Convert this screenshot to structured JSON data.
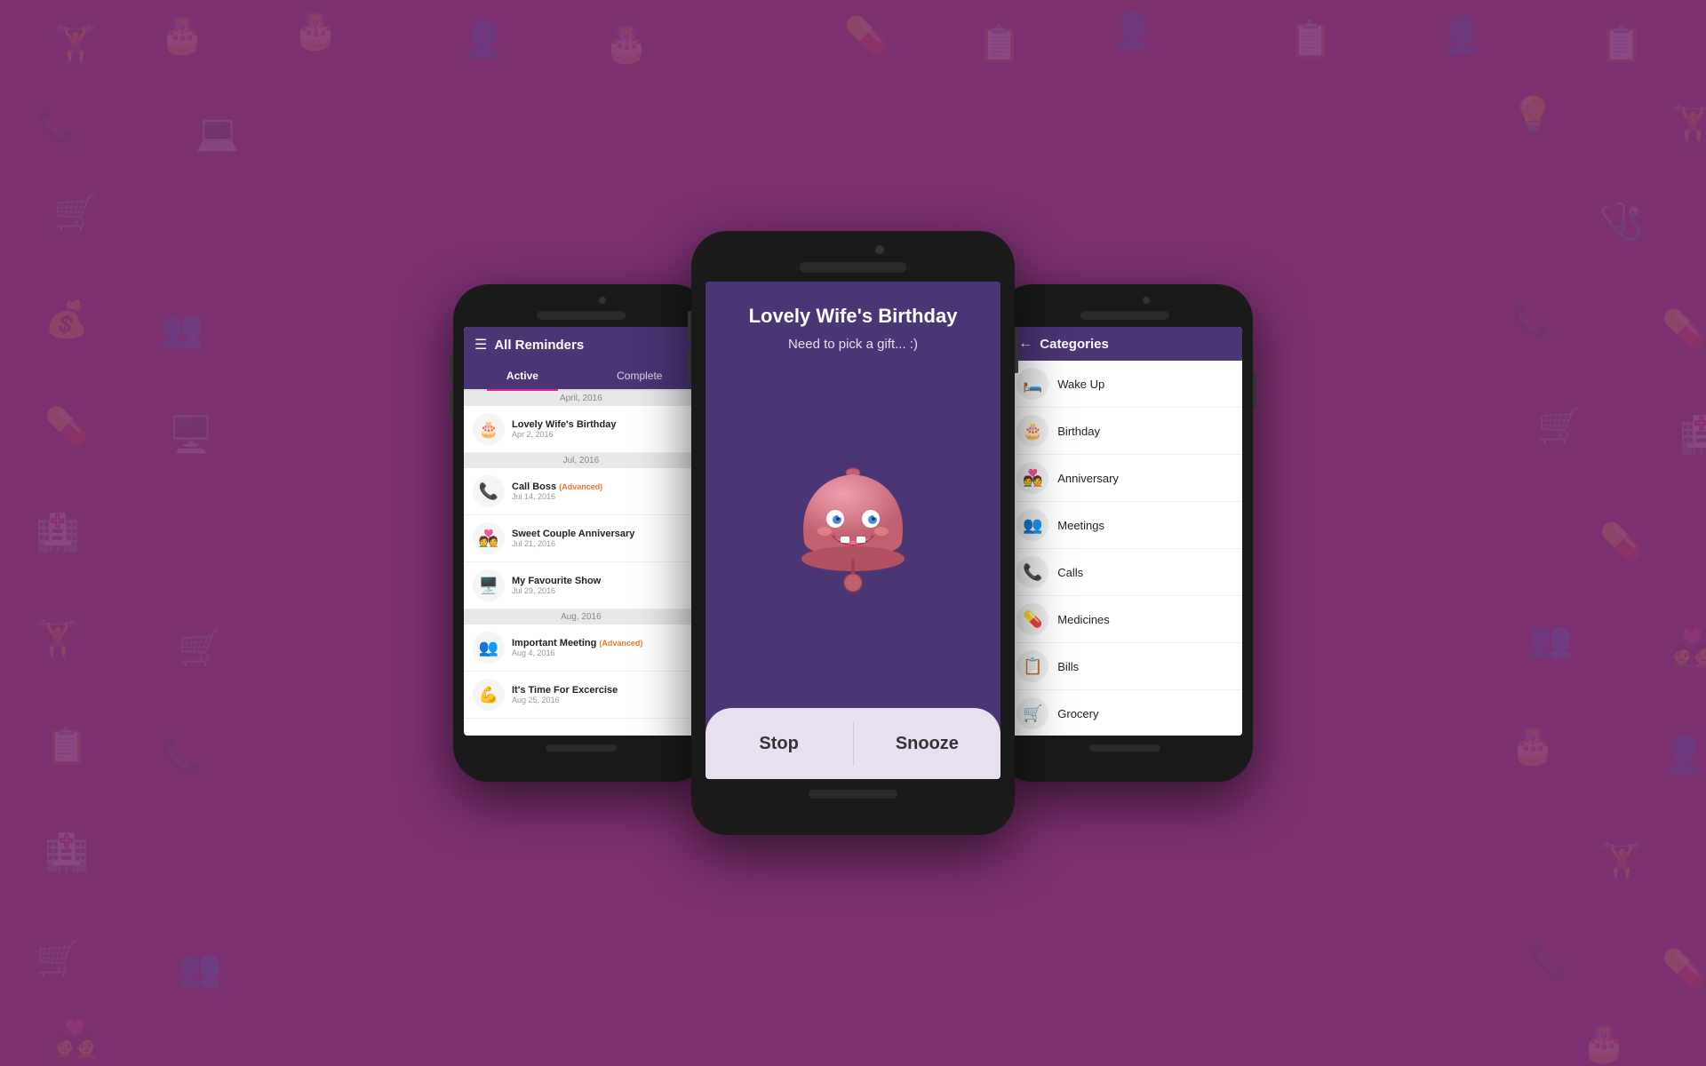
{
  "background": {
    "color": "#7b3070"
  },
  "phone_left": {
    "header": {
      "menu_icon": "☰",
      "title": "All Reminders"
    },
    "tabs": [
      {
        "label": "Active",
        "active": true
      },
      {
        "label": "Complete",
        "active": false
      }
    ],
    "sections": [
      {
        "month": "April, 2016",
        "items": [
          {
            "icon": "🎂",
            "title": "Lovely Wife's Birthday",
            "date": "Apr 2, 2016",
            "badge": ""
          }
        ]
      },
      {
        "month": "Jul, 2016",
        "items": [
          {
            "icon": "📞",
            "title": "Call Boss",
            "date": "Jul 14, 2016",
            "badge": "(Advanced)"
          },
          {
            "icon": "💑",
            "title": "Sweet Couple Anniversary",
            "date": "Jul 21, 2016",
            "badge": ""
          },
          {
            "icon": "🖥️",
            "title": "My Favourite Show",
            "date": "Jul 29, 2016",
            "badge": ""
          }
        ]
      },
      {
        "month": "Aug, 2016",
        "items": [
          {
            "icon": "👥",
            "title": "Important Meeting",
            "date": "Aug 4, 2016",
            "badge": "(Advanced)"
          },
          {
            "icon": "💪",
            "title": "It's Time For Excercise",
            "date": "Aug 25, 2016",
            "badge": ""
          }
        ]
      }
    ]
  },
  "phone_center": {
    "event_title": "Lovely Wife's Birthday",
    "event_subtitle": "Need to pick a gift... :)",
    "stop_label": "Stop",
    "snooze_label": "Snooze"
  },
  "phone_right": {
    "header": {
      "back_arrow": "←",
      "title": "Categories"
    },
    "categories": [
      {
        "icon": "🛏️",
        "name": "Wake Up"
      },
      {
        "icon": "🎂",
        "name": "Birthday"
      },
      {
        "icon": "💑",
        "name": "Anniversary"
      },
      {
        "icon": "👥",
        "name": "Meetings"
      },
      {
        "icon": "📞",
        "name": "Calls"
      },
      {
        "icon": "💊",
        "name": "Medicines"
      },
      {
        "icon": "📋",
        "name": "Bills"
      },
      {
        "icon": "🛒",
        "name": "Grocery"
      }
    ]
  }
}
